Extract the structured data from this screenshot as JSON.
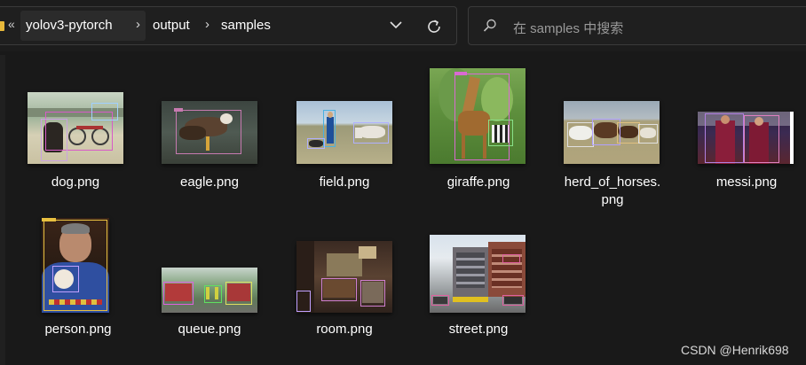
{
  "address_bar": {
    "overflow_glyph": "«",
    "breadcrumbs": [
      "yolov3-pytorch",
      "output",
      "samples"
    ],
    "separator": "›"
  },
  "search": {
    "placeholder": "在 samples 中搜索"
  },
  "files": [
    {
      "name": "dog.png"
    },
    {
      "name": "eagle.png"
    },
    {
      "name": "field.png"
    },
    {
      "name": "giraffe.png"
    },
    {
      "name_line1": "herd_of_horses.",
      "name_line2": "png"
    },
    {
      "name": "messi.png"
    },
    {
      "name": "person.png"
    },
    {
      "name": "queue.png"
    },
    {
      "name": "room.png"
    },
    {
      "name": "street.png"
    }
  ],
  "watermark": "CSDN @Henrik698",
  "colors": {
    "background": "#191919",
    "folder": "#e8b93a",
    "text": "#ffffff",
    "placeholder": "#9a9a9a"
  }
}
